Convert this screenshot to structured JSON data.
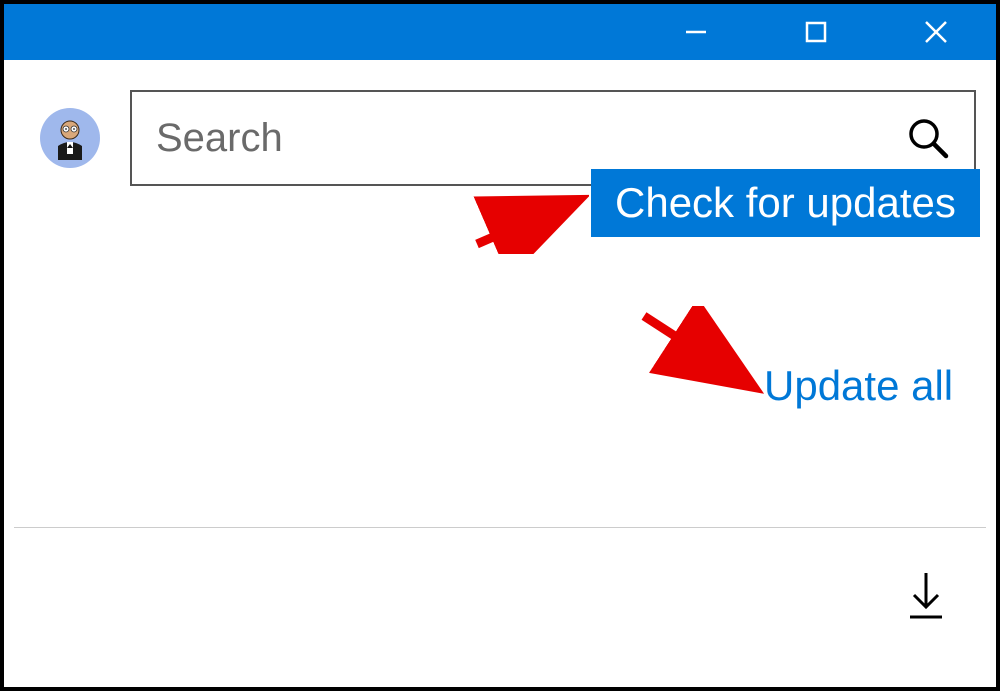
{
  "titlebar": {
    "minimize": "Minimize",
    "maximize": "Maximize",
    "close": "Close"
  },
  "search": {
    "placeholder": "Search"
  },
  "buttons": {
    "check_for_updates": "Check for updates",
    "update_all": "Update all"
  }
}
